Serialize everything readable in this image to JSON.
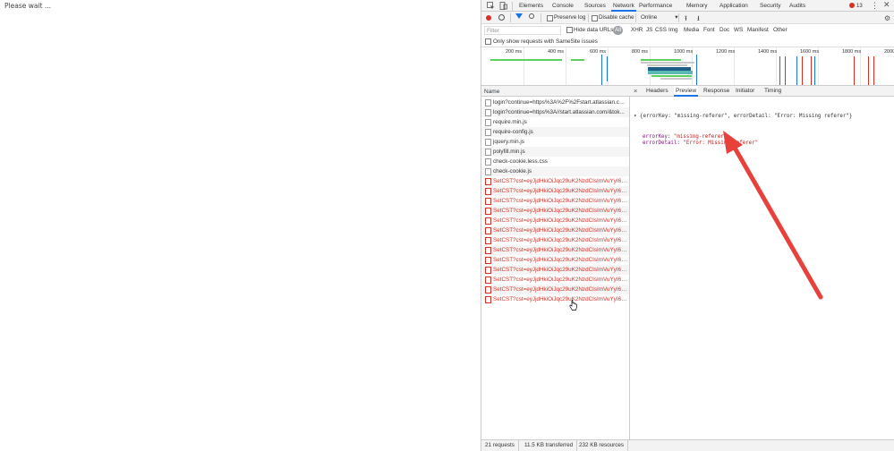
{
  "page": {
    "text": "Please wait ..."
  },
  "devtools": {
    "main_tabs": [
      "Elements",
      "Console",
      "Sources",
      "Network",
      "Performance",
      "Memory",
      "Application",
      "Security",
      "Audits"
    ],
    "active_main_tab": "Network",
    "error_count": "13",
    "toolbar": {
      "preserve_log": "Preserve log",
      "disable_cache": "Disable cache",
      "throttling": "Online"
    },
    "filter": {
      "placeholder": "Filter",
      "hide_data_urls": "Hide data URLs",
      "types": [
        "All",
        "XHR",
        "JS",
        "CSS",
        "Img",
        "Media",
        "Font",
        "Doc",
        "WS",
        "Manifest",
        "Other"
      ],
      "same_site": "Only show requests with SameSite issues"
    },
    "overview": {
      "ticks": [
        "200 ms",
        "400 ms",
        "600 ms",
        "800 ms",
        "1000 ms",
        "1200 ms",
        "1400 ms",
        "1600 ms",
        "1800 ms",
        "2000"
      ]
    },
    "requests": {
      "column_name": "Name",
      "rows": [
        {
          "name": "login?continue=https%3A%2F%2Fstart.atlassian.com...",
          "error": false
        },
        {
          "name": "login?continue=https%3A//start.atlassian.com/&tok...",
          "error": false
        },
        {
          "name": "require.min.js",
          "error": false
        },
        {
          "name": "require-config.js",
          "error": false
        },
        {
          "name": "jquery.min.js",
          "error": false
        },
        {
          "name": "polyfill.min.js",
          "error": false
        },
        {
          "name": "check-cookie.less.css",
          "error": false
        },
        {
          "name": "check-cookie.js",
          "error": false
        },
        {
          "name": "SetCST?cst=eyJjdHkiOiJqc29uK2NzdCIsImVuYyI6IkEy...",
          "error": true
        },
        {
          "name": "SetCST?cst=eyJjdHkiOiJqc29uK2NzdCIsImVuYyI6IkEy...",
          "error": true
        },
        {
          "name": "SetCST?cst=eyJjdHkiOiJqc29uK2NzdCIsImVuYyI6IkEy...",
          "error": true
        },
        {
          "name": "SetCST?cst=eyJjdHkiOiJqc29uK2NzdCIsImVuYyI6IkEy...",
          "error": true
        },
        {
          "name": "SetCST?cst=eyJjdHkiOiJqc29uK2NzdCIsImVuYyI6IkEy...",
          "error": true
        },
        {
          "name": "SetCST?cst=eyJjdHkiOiJqc29uK2NzdCIsImVuYyI6IkEy...",
          "error": true
        },
        {
          "name": "SetCST?cst=eyJjdHkiOiJqc29uK2NzdCIsImVuYyI6IkEy...",
          "error": true
        },
        {
          "name": "SetCST?cst=eyJjdHkiOiJqc29uK2NzdCIsImVuYyI6IkEy...",
          "error": true
        },
        {
          "name": "SetCST?cst=eyJjdHkiOiJqc29uK2NzdCIsImVuYyI6IkEy...",
          "error": true
        },
        {
          "name": "SetCST?cst=eyJjdHkiOiJqc29uK2NzdCIsImVuYyI6IkEy...",
          "error": true
        },
        {
          "name": "SetCST?cst=eyJjdHkiOiJqc29uK2NzdCIsImVuYyI6IkEy...",
          "error": true
        },
        {
          "name": "SetCST?cst=eyJjdHkiOiJqc29uK2NzdCIsImVuYyI6IkEy...",
          "error": true
        },
        {
          "name": "SetCST?cst=eyJjdHkiOiJqc29uK2NzdCIsImVuYyI6IkEy...",
          "error": true
        }
      ]
    },
    "detail": {
      "close": "×",
      "tabs": [
        "Headers",
        "Preview",
        "Response",
        "Initiator",
        "Timing"
      ],
      "active_tab": "Preview",
      "preview": {
        "summary": "{errorKey: \"missing-referer\", errorDetail: \"Error: Missing referer\"}",
        "fields": [
          {
            "key": "errorKey",
            "value": "\"missing-referer\""
          },
          {
            "key": "errorDetail",
            "value": "\"Error: Missing referer\""
          }
        ]
      }
    },
    "footer": {
      "requests": "21 requests",
      "transferred": "11.5 KB transferred",
      "resources": "232 KB resources"
    }
  },
  "colors": {
    "accent": "#1a73e8",
    "error": "#d93025",
    "annotation_arrow": "#e8413c"
  }
}
